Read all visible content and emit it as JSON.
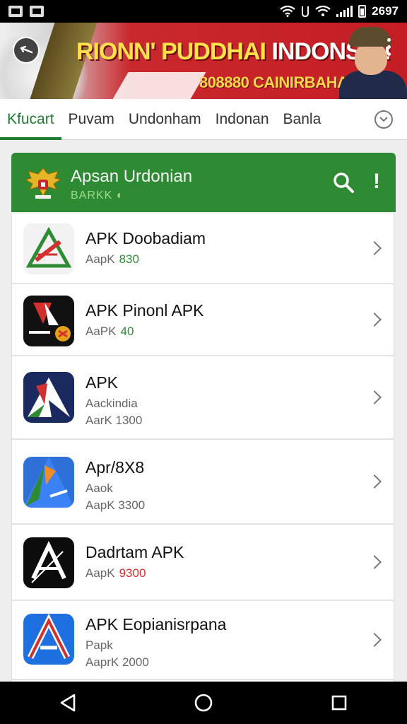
{
  "status_bar": {
    "time": "2697",
    "icons": [
      "notification-icon",
      "gallery-icon",
      "wifi-icon",
      "signal-icon",
      "battery-icon"
    ]
  },
  "banner": {
    "title_part1": "RIONN' PUDDHAI",
    "title_part2": "INDONSIA!",
    "subtitle": "808880 CAINIRBAHAN"
  },
  "tabs": [
    {
      "label": "Kfucart",
      "active": true
    },
    {
      "label": "Puvam",
      "active": false
    },
    {
      "label": "Undonham",
      "active": false
    },
    {
      "label": "Indonan",
      "active": false
    },
    {
      "label": "Banla",
      "active": false
    }
  ],
  "header_card": {
    "title": "Apsan Urdonian",
    "subtitle": "BARKK",
    "color": "#2e8b34"
  },
  "apps": [
    {
      "name": "APK Doobadiam",
      "line2_label": "AapK",
      "line2_value": "830",
      "line2_color": "#2e8b34",
      "line3": ""
    },
    {
      "name": "APK Pinonl  APK",
      "line2_label": "AaPK",
      "line2_value": "40",
      "line2_color": "#2e8b34",
      "line3": ""
    },
    {
      "name": "APK",
      "line2_label": "Aackindia",
      "line2_value": "",
      "line2_color": "#666666",
      "line3": "AarK  1300"
    },
    {
      "name": "Apr/8X8",
      "line2_label": "Aaok",
      "line2_value": "",
      "line2_color": "#666666",
      "line3": "AapK  3300"
    },
    {
      "name": "Dadrtam APK",
      "line2_label": "AapK",
      "line2_value": "9300",
      "line2_color": "#d32f2f",
      "line3": ""
    },
    {
      "name": "APK Eopianisrpana",
      "line2_label": "Papk",
      "line2_value": "",
      "line2_color": "#666666",
      "line3": "AaprK  2000"
    }
  ],
  "navbar": [
    "back-icon",
    "home-icon",
    "recents-icon"
  ]
}
